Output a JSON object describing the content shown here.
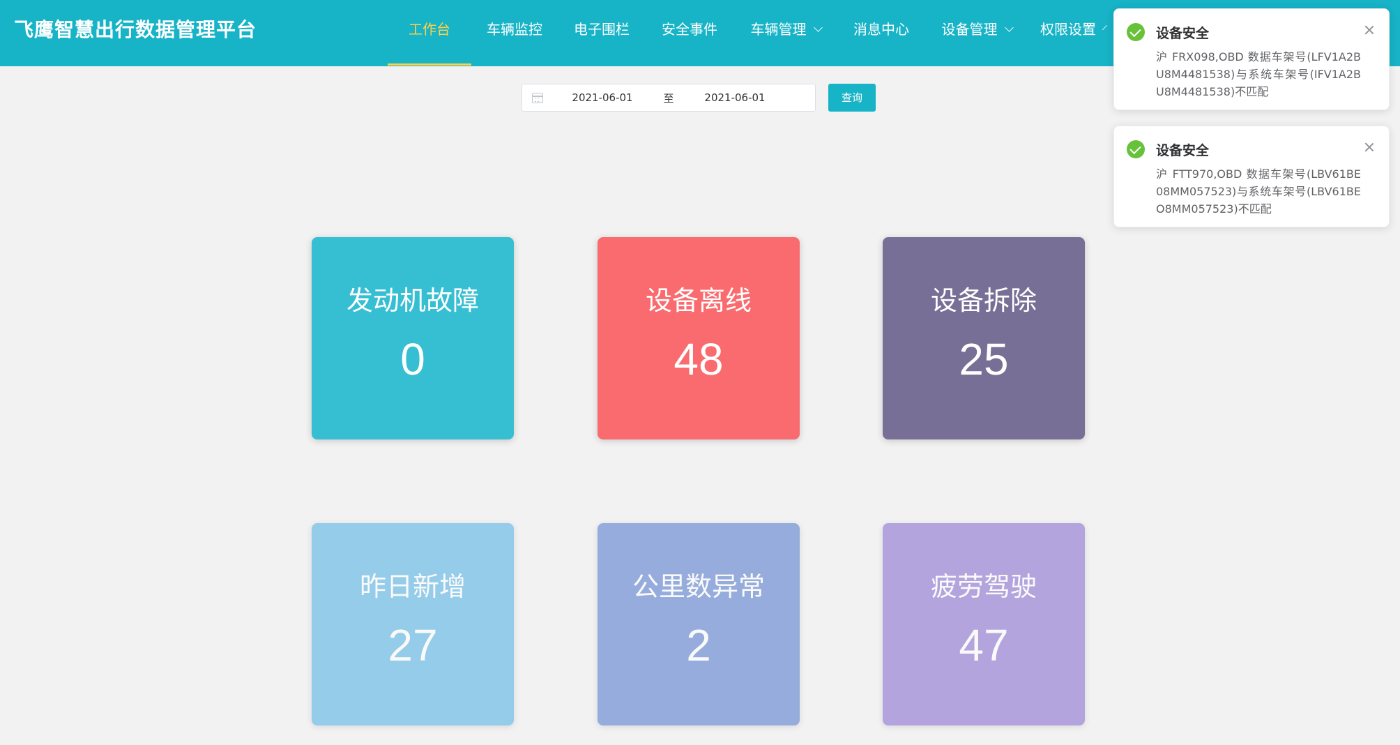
{
  "app": {
    "title": "飞鹰智慧出行数据管理平台"
  },
  "nav": {
    "items": [
      {
        "label": "工作台",
        "active": true
      },
      {
        "label": "车辆监控"
      },
      {
        "label": "电子围栏"
      },
      {
        "label": "安全事件"
      },
      {
        "label": "车辆管理",
        "dropdown": true
      },
      {
        "label": "消息中心"
      },
      {
        "label": "设备管理",
        "dropdown": true
      },
      {
        "label": "权限设置",
        "dropdown": true
      }
    ]
  },
  "filter": {
    "start_date": "2021-06-01",
    "separator": "至",
    "end_date": "2021-06-01",
    "query_label": "查询"
  },
  "cards": [
    {
      "title": "发动机故障",
      "value": "0",
      "color": "#36bfd2"
    },
    {
      "title": "设备离线",
      "value": "48",
      "color": "#f96b6e"
    },
    {
      "title": "设备拆除",
      "value": "25",
      "color": "#776f96"
    },
    {
      "title": "昨日新增",
      "value": "27",
      "color": "#5cb6e4"
    },
    {
      "title": "公里数异常",
      "value": "2",
      "color": "#5f82cf"
    },
    {
      "title": "疲劳驾驶",
      "value": "47",
      "color": "#8e75d3"
    }
  ],
  "notifications": [
    {
      "title": "设备安全",
      "body": "沪 FRX098,OBD 数据车架号(LFV1A2BU8M4481538)与系统车架号(IFV1A2BU8M4481538)不匹配",
      "status_color": "#67c23a"
    },
    {
      "title": "设备安全",
      "body": "沪 FTT970,OBD 数据车架号(LBV61BE08MM057523)与系统车架号(LBV61BEO8MM057523)不匹配",
      "status_color": "#67c23a"
    }
  ]
}
